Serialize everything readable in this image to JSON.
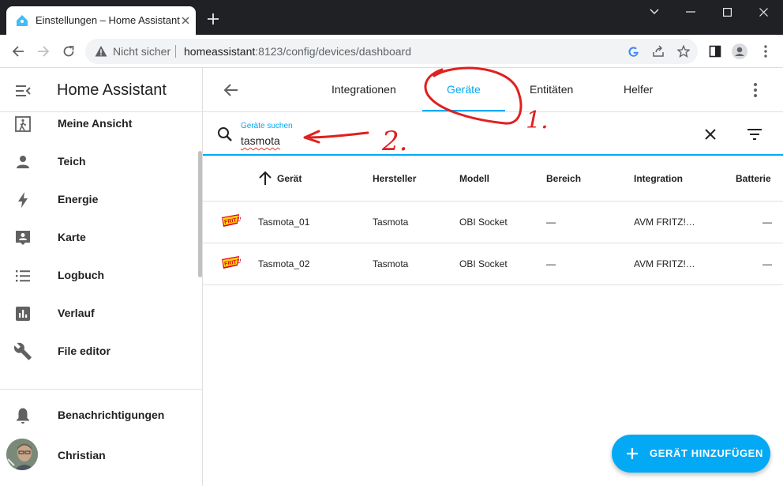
{
  "browser": {
    "tab_title": "Einstellungen – Home Assistant",
    "security_label": "Nicht sicher",
    "url_host": "homeassistant",
    "url_rest": ":8123/config/devices/dashboard"
  },
  "sidebar": {
    "title": "Home Assistant",
    "items": [
      {
        "label": "Meine Ansicht",
        "icon": "person-walking-icon"
      },
      {
        "label": "Teich",
        "icon": "person-icon"
      },
      {
        "label": "Energie",
        "icon": "lightning-icon"
      },
      {
        "label": "Karte",
        "icon": "map-account-icon"
      },
      {
        "label": "Logbuch",
        "icon": "list-icon"
      },
      {
        "label": "Verlauf",
        "icon": "chart-icon"
      },
      {
        "label": "File editor",
        "icon": "wrench-icon"
      }
    ],
    "notifications_label": "Benachrichtigungen",
    "user_label": "Christian"
  },
  "topbar": {
    "tabs": [
      "Integrationen",
      "Geräte",
      "Entitäten",
      "Helfer"
    ],
    "active_tab": "Geräte"
  },
  "search": {
    "label": "Geräte suchen",
    "value": "tasmota"
  },
  "table": {
    "columns": [
      "Gerät",
      "Hersteller",
      "Modell",
      "Bereich",
      "Integration",
      "Batterie"
    ],
    "rows": [
      {
        "device": "Tasmota_01",
        "manufacturer": "Tasmota",
        "model": "OBI Socket",
        "area": "—",
        "integration": "AVM FRITZ!…",
        "battery": "—"
      },
      {
        "device": "Tasmota_02",
        "manufacturer": "Tasmota",
        "model": "OBI Socket",
        "area": "—",
        "integration": "AVM FRITZ!…",
        "battery": "—"
      }
    ]
  },
  "fab": {
    "label": "GERÄT HINZUFÜGEN"
  },
  "annotations": {
    "mark_1": "1.",
    "mark_2": "2."
  },
  "colors": {
    "accent": "#03a9f4",
    "annotation": "#e0201e",
    "chrome_dark": "#202124"
  }
}
